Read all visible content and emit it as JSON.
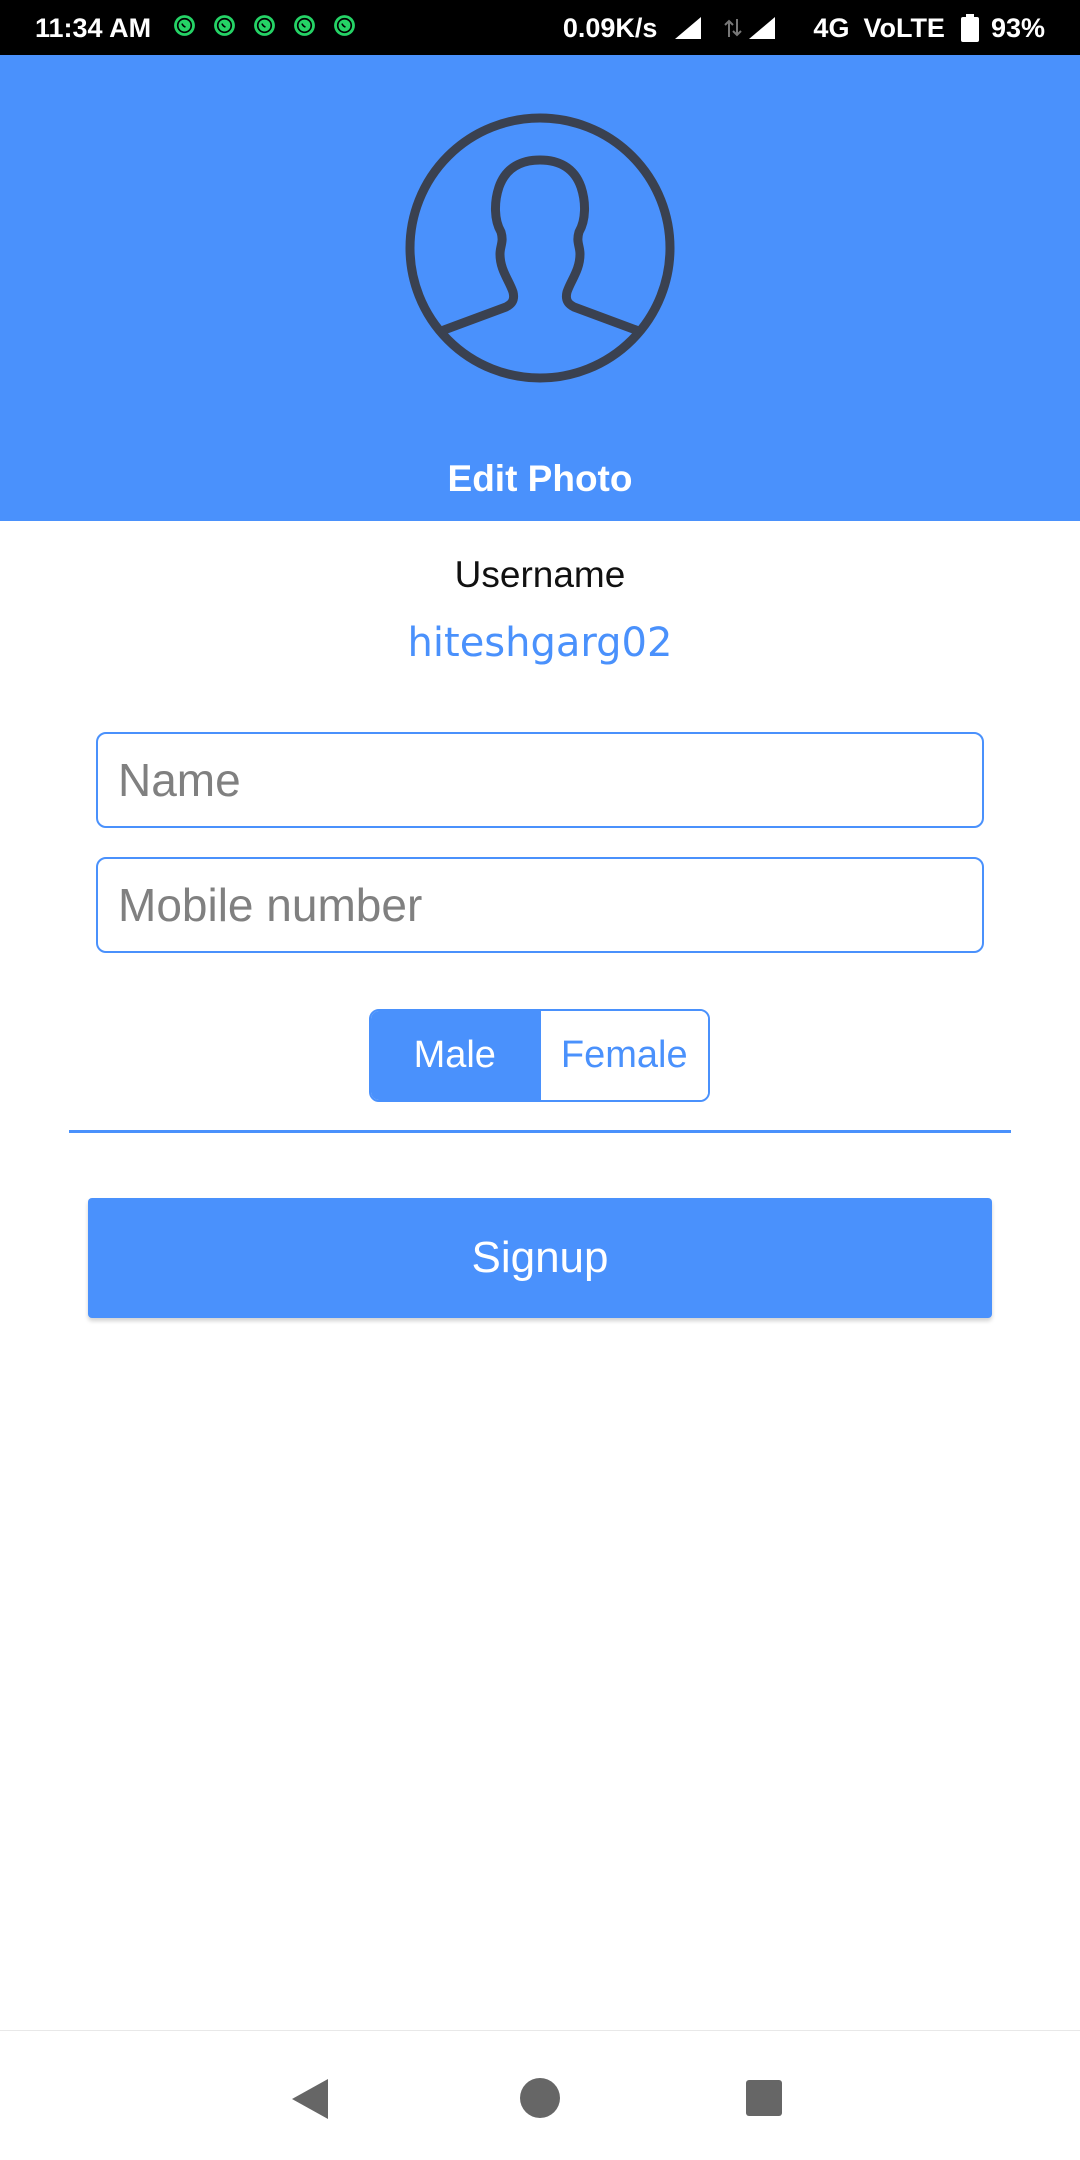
{
  "status_bar": {
    "time": "11:34 AM",
    "notification_icons": [
      "whatsapp-icon",
      "whatsapp-icon",
      "whatsapp-icon",
      "whatsapp-icon",
      "whatsapp-icon"
    ],
    "net_speed": "0.09K/s",
    "network_type": "4G",
    "volte": "VoLTE",
    "battery": "93%"
  },
  "header": {
    "avatar_icon": "user-avatar-icon",
    "edit_photo_label": "Edit Photo",
    "background_color": "#4a91fc"
  },
  "profile": {
    "username_label": "Username",
    "username_value": "hiteshgarg02"
  },
  "form": {
    "name_placeholder": "Name",
    "name_value": "",
    "mobile_placeholder": "Mobile number",
    "mobile_value": "",
    "gender_options": [
      "Male",
      "Female"
    ],
    "gender_selected": "Male",
    "signup_label": "Signup"
  },
  "nav_bar": {
    "icons": [
      "back-icon",
      "home-icon",
      "recents-icon"
    ]
  },
  "colors": {
    "accent": "#4a91fc",
    "avatar_stroke": "#3a4150"
  }
}
